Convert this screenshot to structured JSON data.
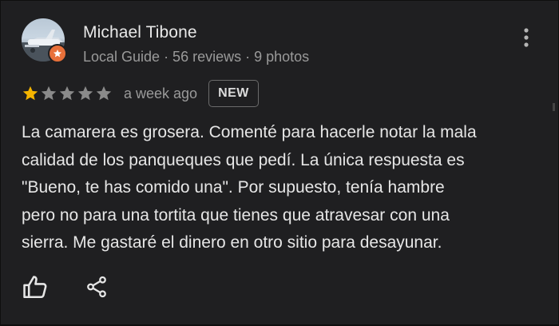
{
  "review": {
    "author": {
      "name": "Michael Tibone",
      "meta": "Local Guide · 56 reviews · 9 photos",
      "badge_color": "#e8703a"
    },
    "rating": {
      "value": 1,
      "max": 5,
      "filled_color": "#f4b400",
      "empty_color": "#8a8a8a"
    },
    "time": "a week ago",
    "badge": "NEW",
    "text": "La camarera es grosera. Comenté para hacerle notar la mala\ncalidad de los panqueques que pedí.  La única respuesta es\n\"Bueno, te has comido una\". Por supuesto, tenía hambre\npero no para una tortita que tienes que atravesar con una\nsierra. Me gastaré el dinero en otro sitio para desayunar.",
    "actions": {
      "like_icon": "thumbs-up-icon",
      "share_icon": "share-icon"
    },
    "menu_icon": "more-vertical-icon"
  }
}
